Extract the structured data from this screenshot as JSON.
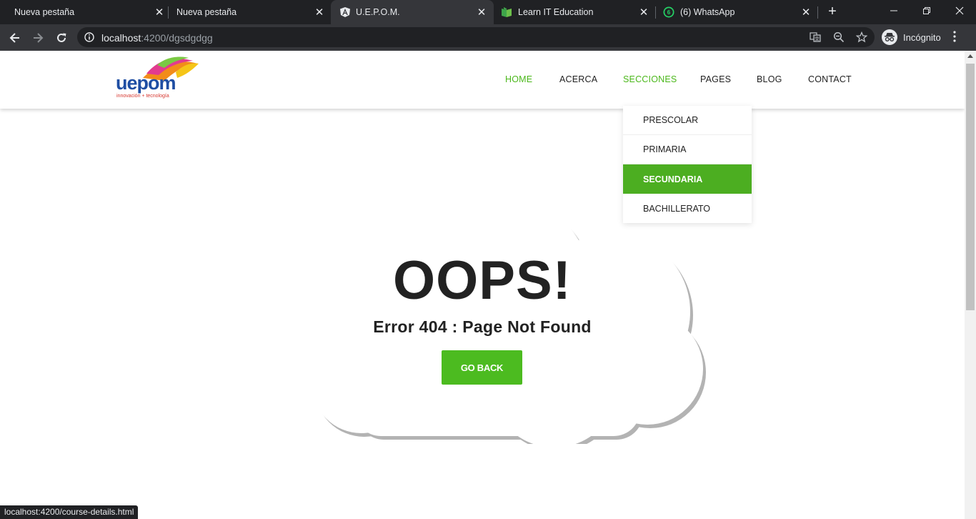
{
  "browser": {
    "tabs": [
      {
        "title": "Nueva pestaña",
        "favicon": "none",
        "close": "✕"
      },
      {
        "title": "Nueva pestaña",
        "favicon": "none",
        "close": "✕"
      },
      {
        "title": "U.E.P.O.M.",
        "favicon": "angular-icon",
        "close": "✕"
      },
      {
        "title": "Learn IT Education",
        "favicon": "book-icon",
        "close": "✕"
      },
      {
        "title": "(6) WhatsApp",
        "favicon": "whatsapp-icon",
        "badge": "6",
        "close": "✕"
      }
    ],
    "new_tab": "+",
    "url_host": "localhost",
    "url_path": ":4200/dgsdgdgg",
    "profile_label": "Incógnito",
    "status_url": "localhost:4200/course-details.html"
  },
  "site": {
    "logo_text": "uepom",
    "logo_tagline": "innovación + tecnología",
    "nav": [
      "HOME",
      "ACERCA",
      "SECCIONES",
      "PAGES",
      "BLOG",
      "CONTACT"
    ],
    "dropdown": [
      "PRESCOLAR",
      "PRIMARIA",
      "SECUNDARIA",
      "BACHILLERATO"
    ]
  },
  "error": {
    "heading": "OOPS!",
    "message": "Error 404 : Page Not Found",
    "button": "GO BACK"
  },
  "colors": {
    "accent_green": "#4cb81c",
    "dark_chrome": "#202124",
    "toolbar": "#35363a"
  }
}
